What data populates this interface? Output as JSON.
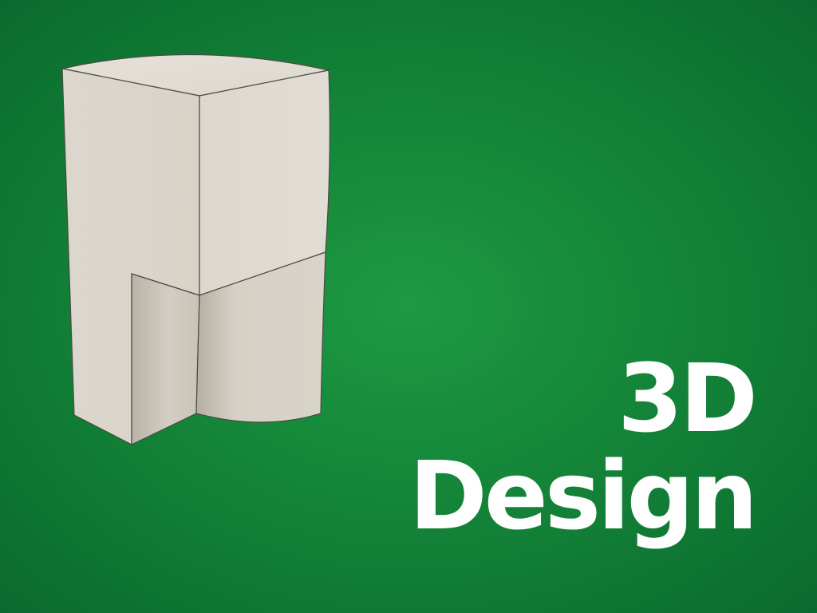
{
  "title": {
    "line1": "3D",
    "line2": "Design"
  },
  "colors": {
    "background_center": "#1d9a42",
    "background_edge": "#0a6b2e",
    "model_face_light": "#e0dbd1",
    "model_face_mid": "#dcd7cc",
    "model_face_shadow": "#cdc7bb",
    "model_edge": "#4a4a44",
    "title_text": "#ffffff"
  }
}
